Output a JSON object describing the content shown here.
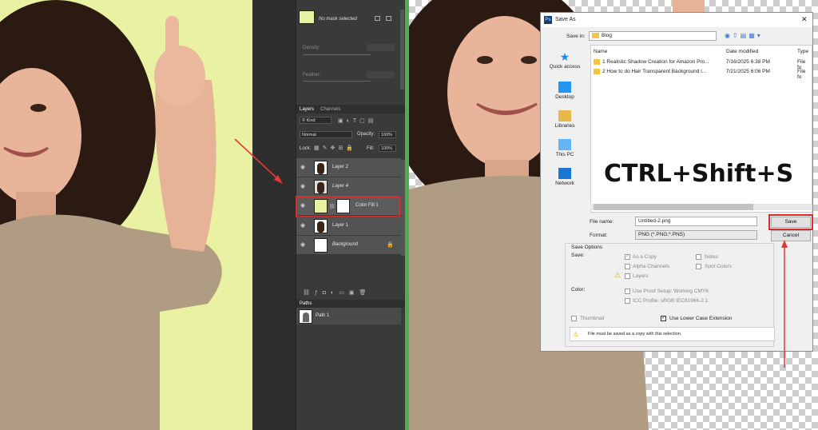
{
  "left_panel": {
    "properties": {
      "mask_status": "No mask selected",
      "density_label": "Density:",
      "feather_label": "Feather:"
    },
    "layers_panel": {
      "tabs": [
        "Layers",
        "Channels"
      ],
      "kind_label": "Kind",
      "blend_mode": "Normal",
      "opacity_label": "Opacity:",
      "opacity_value": "100%",
      "lock_label": "Lock:",
      "fill_label": "Fill:",
      "fill_value": "100%",
      "layers": [
        {
          "name": "Layer 2"
        },
        {
          "name": "Layer 4"
        },
        {
          "name": "Color Fill 1",
          "selected": true
        },
        {
          "name": "Layer 1"
        },
        {
          "name": "Background"
        }
      ]
    },
    "paths_panel": {
      "tab": "Paths",
      "items": [
        "Path 1"
      ]
    },
    "fill_color": "#e9f2a3"
  },
  "save_dialog": {
    "title": "Save As",
    "save_in_label": "Save in:",
    "save_in_value": "Blog",
    "nav": [
      "Quick access",
      "Desktop",
      "Libraries",
      "This PC",
      "Network"
    ],
    "columns": [
      "Name",
      "Date modified",
      "Type"
    ],
    "files": [
      {
        "name": "1 Realistic Shadow Creation for Amazon Pro...",
        "date": "7/16/2025 6:38 PM",
        "type": "File fo"
      },
      {
        "name": "2 How to do Hair Transparent Background i...",
        "date": "7/21/2025 6:06 PM",
        "type": "File fo"
      }
    ],
    "shortcut_overlay": "CTRL+Shift+S",
    "file_name_label": "File name:",
    "file_name_value": "Untitled-2.png",
    "format_label": "Format:",
    "format_value": "PNG (*.PNG;*.PNS)",
    "save_button": "Save",
    "cancel_button": "Cancel",
    "save_options_title": "Save Options",
    "save_label": "Save:",
    "opt_as_copy": "As a Copy",
    "opt_notes": "Notes",
    "opt_alpha": "Alpha Channels",
    "opt_spot": "Spot Colors",
    "opt_layers": "Layers",
    "color_label": "Color:",
    "opt_proof": "Use Proof Setup:  Working CMYK",
    "opt_icc": "ICC Profile:  sRGB IEC61966-2.1",
    "opt_thumbnail": "Thumbnail",
    "opt_lowercase": "Use Lower Case Extension",
    "warning_text": "File must be saved as a copy with this selection."
  },
  "colors": {
    "highlight": "#d32f2f",
    "divider": "#4caf50"
  }
}
